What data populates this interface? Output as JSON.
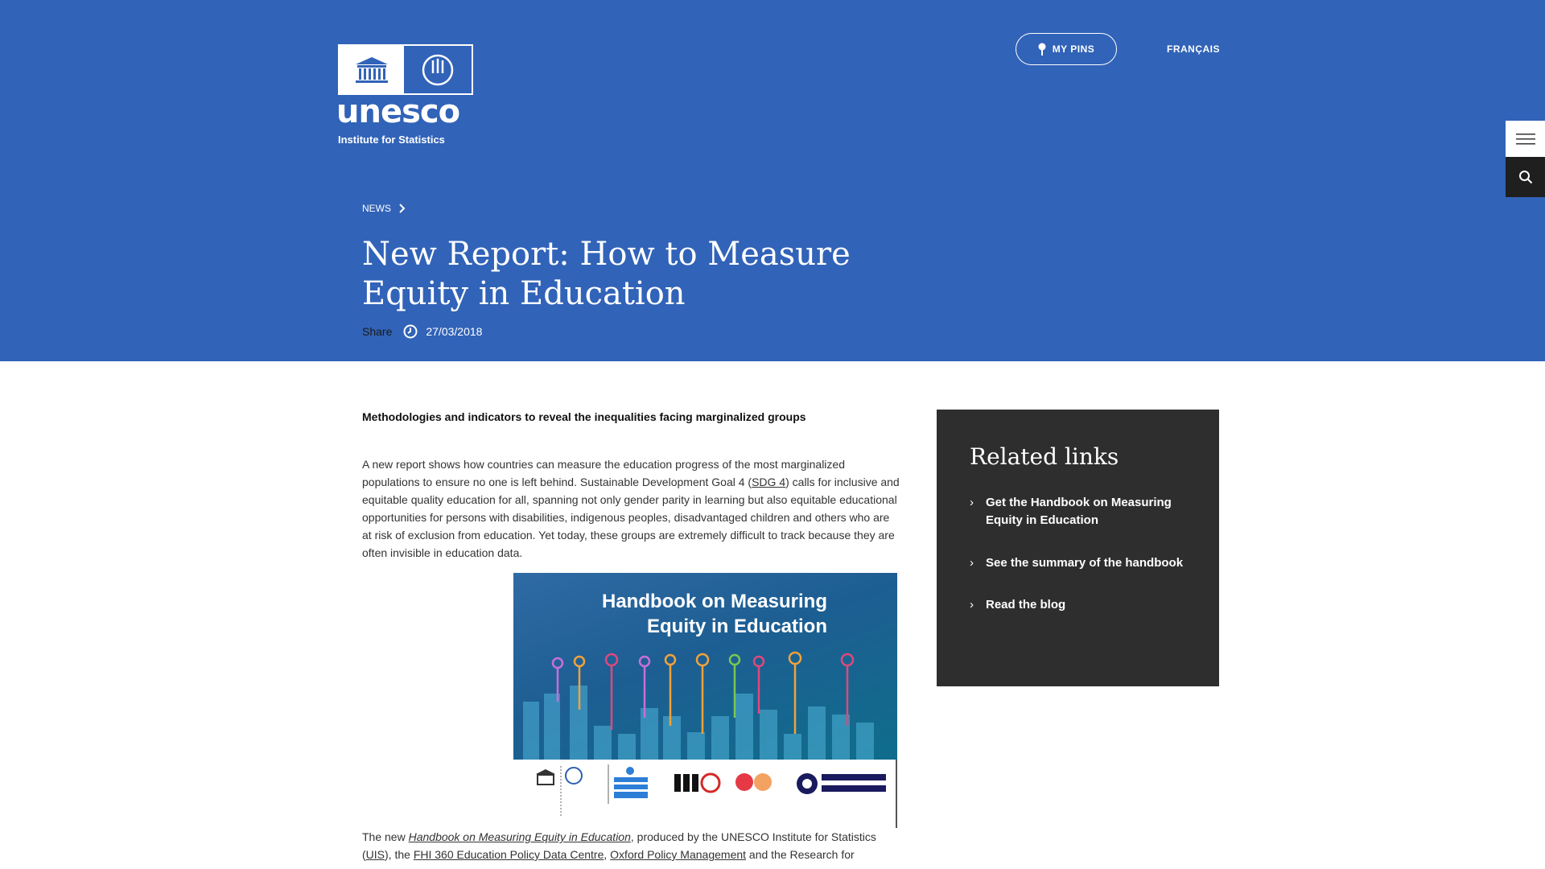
{
  "header": {
    "logo_word": "unesco",
    "logo_sub": "Institute for Statistics",
    "my_pins_label": "MY PINS",
    "language_label": "FRANÇAIS"
  },
  "breadcrumb": {
    "label": "NEWS"
  },
  "article": {
    "title": "New Report: How to Measure Equity in Education",
    "share_label": "Share",
    "date": "27/03/2018",
    "lead": "Methodologies and indicators to reveal the inequalities facing marginalized groups",
    "para1_a": "A new report shows how countries can measure the education progress of the most marginalized populations to ensure no one is left behind. Sustainable Development Goal 4 (",
    "para1_link": "SDG 4",
    "para1_b": ") calls for inclusive and equitable quality education for all, spanning not only gender parity in learning but also equitable educational opportunities for persons with disabilities, indigenous peoples, disadvantaged children and others who are at risk of exclusion from education. Yet today, these groups are extremely difficult to track because they are often invisible in education data.",
    "cover_title": "Handbook on Measuring Equity in Education",
    "para2_a": "The new ",
    "para2_link1": "Handbook on Measuring Equity in Education",
    "para2_b": ", produced by the UNESCO Institute for Statistics (",
    "para2_link2": "UIS",
    "para2_c": "), the ",
    "para2_link3": "FHI 360 Education Policy Data Centre",
    "para2_d": ", ",
    "para2_link4": "Oxford Policy Management",
    "para2_e": " and the Research for"
  },
  "related": {
    "title": "Related links",
    "items": [
      {
        "label": "Get the Handbook on Measuring Equity in Education"
      },
      {
        "label": "See the summary of the handbook"
      },
      {
        "label": "Read the blog"
      }
    ]
  },
  "colors": {
    "hero_blue": "#3163b8",
    "related_bg": "#2e2e2e"
  },
  "icons": [
    "pin-icon",
    "menu-icon",
    "search-icon",
    "chevron-right-icon",
    "clock-icon"
  ]
}
